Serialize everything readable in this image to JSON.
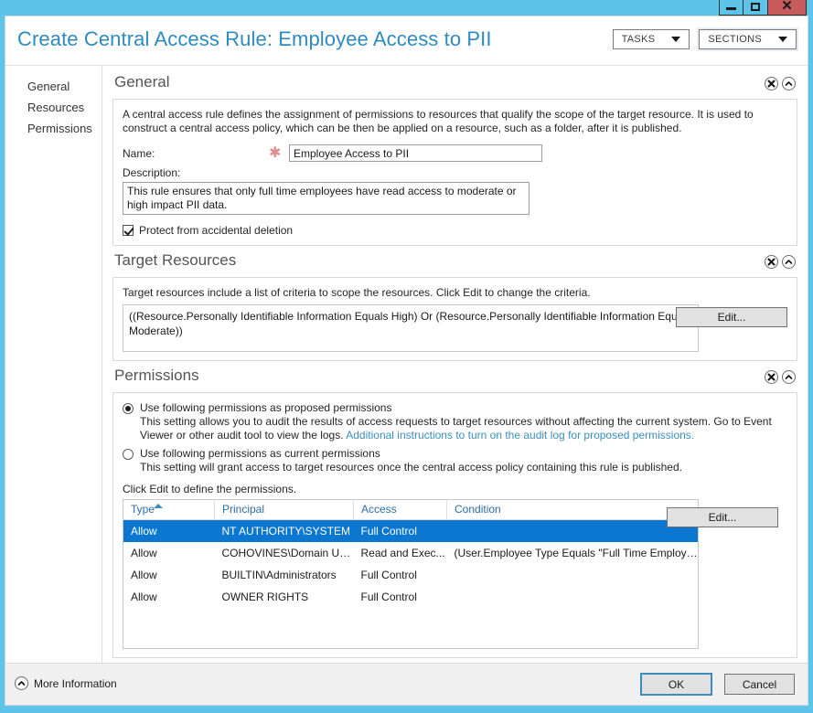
{
  "window": {
    "controls": [
      {
        "name": "minimize",
        "label": "Minimize"
      },
      {
        "name": "maximize",
        "label": "Maximize"
      },
      {
        "name": "close",
        "label": "Close"
      }
    ],
    "accent_color": "#5BC4E8",
    "close_color": "#C75B5B"
  },
  "header": {
    "title": "Create Central Access Rule: Employee Access to PII",
    "title_color": "#2E8BC0",
    "tasks_label": "TASKS",
    "sections_label": "SECTIONS"
  },
  "sidebar": {
    "items": [
      {
        "label": "General"
      },
      {
        "label": "Resources"
      },
      {
        "label": "Permissions"
      }
    ]
  },
  "general": {
    "section_title": "General",
    "description": "A central access rule defines the assignment of permissions to resources that qualify the scope of the target resource. It is used to construct a central access policy, which can be then be applied on a resource, such as a folder, after it is published.",
    "name_label": "Name:",
    "required_marker": "✱",
    "name_value": "Employee Access to PII",
    "name_placeholder": "",
    "description_label": "Description:",
    "description_value": "This rule ensures that only full time employees have read access to moderate or high impact PII data.",
    "description_placeholder": "",
    "protect_label": "Protect from accidental deletion",
    "protect_checked": true
  },
  "target_resources": {
    "section_title": "Target Resources",
    "note": "Target resources include a list of criteria to scope the resources. Click Edit to change the criteria.",
    "criteria": "((Resource.Personally Identifiable Information Equals High) Or (Resource.Personally Identifiable Information Equals Moderate))",
    "edit_label": "Edit..."
  },
  "permissions": {
    "section_title": "Permissions",
    "option_proposed_label": "Use following permissions as proposed permissions",
    "option_proposed_desc_1": "This setting allows you to audit the results of access requests to target resources without affecting the current system. Go to Event Viewer or other audit tool to view the logs. ",
    "option_proposed_link": "Additional instructions to turn on the audit log for proposed permissions.",
    "option_proposed_selected": true,
    "option_current_label": "Use following permissions as current permissions",
    "option_current_desc": "This setting will grant access to target resources once the central access policy containing this rule is published.",
    "option_current_selected": false,
    "edit_note": "Click Edit to define the permissions.",
    "edit_label": "Edit...",
    "table": {
      "columns": [
        "Type",
        "Principal",
        "Access",
        "Condition"
      ],
      "sorted_column": "Type",
      "sort_direction": "asc",
      "selected_row_index": 0,
      "rows": [
        {
          "type": "Allow",
          "principal": "NT AUTHORITY\\SYSTEM",
          "access": "Full Control",
          "condition": ""
        },
        {
          "type": "Allow",
          "principal": "COHOVINES\\Domain Us...",
          "access": "Read and Exec...",
          "condition": "(User.Employee Type Equals \"Full Time Employee\")"
        },
        {
          "type": "Allow",
          "principal": "BUILTIN\\Administrators",
          "access": "Full Control",
          "condition": ""
        },
        {
          "type": "Allow",
          "principal": "OWNER RIGHTS",
          "access": "Full Control",
          "condition": ""
        }
      ]
    }
  },
  "footer": {
    "more_information_label": "More Information",
    "ok_label": "OK",
    "cancel_label": "Cancel"
  }
}
